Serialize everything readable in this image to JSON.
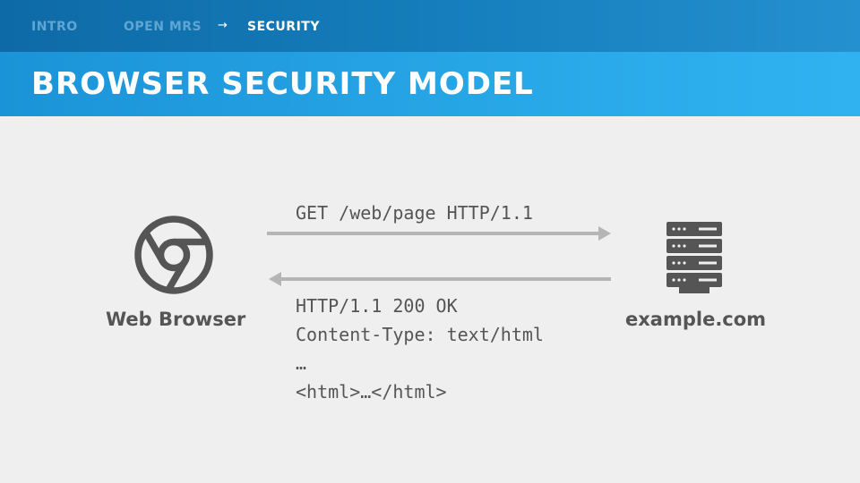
{
  "breadcrumbs": [
    {
      "label": "INTRO",
      "state": "inactive"
    },
    {
      "label": "OPEN MRS",
      "state": "inactive"
    },
    {
      "label": "SECURITY",
      "state": "active"
    }
  ],
  "breadcrumb_separator": "→",
  "title": "BROWSER SECURITY MODEL",
  "diagram": {
    "client": {
      "label": "Web Browser",
      "icon": "chrome-browser-icon"
    },
    "server": {
      "label": "example.com",
      "icon": "server-rack-icon"
    },
    "request": {
      "line": "GET /web/page HTTP/1.1"
    },
    "response": {
      "status_line": "HTTP/1.1 200 OK",
      "header_line": "Content-Type: text/html",
      "ellipsis_line": "…",
      "body_line": "<html>…</html>"
    }
  },
  "colors": {
    "topbar": "#1478b6",
    "titlebar": "#27a6e6",
    "arrow": "#b5b5b5",
    "icon": "#555555",
    "background": "#efefef"
  }
}
